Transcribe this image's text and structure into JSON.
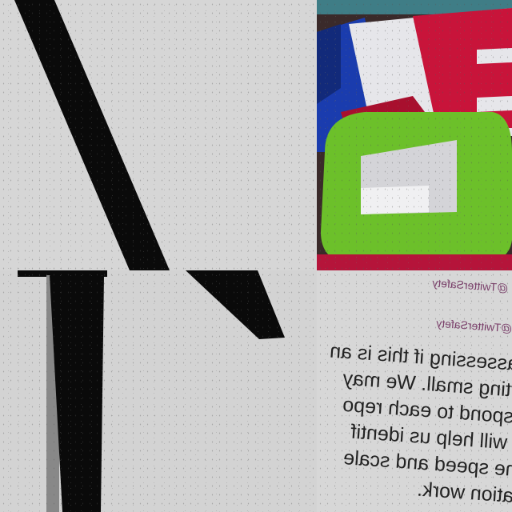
{
  "tiles": {
    "top_left": {
      "subject": "black diagonal stroke on light grey"
    },
    "top_right": {
      "subject": "colorful 3D letter blocks",
      "colors": {
        "red": "#c8143a",
        "green": "#6cc02a",
        "blue": "#1a3cae",
        "white": "#e6e6ea"
      }
    },
    "bottom_left": {
      "subject": "black vertical stroke with serif fragment"
    },
    "bottom_right": {
      "subject": "mirrored tweet text fragment",
      "handles": [
        "@TwitterSafety",
        "to @TwitterSafety"
      ],
      "lines": [
        "an assessing if this is an",
        "starting small. We may",
        "t respond to each repo",
        "but will help us identif",
        "e the speed and scale",
        "rmation work."
      ]
    }
  }
}
